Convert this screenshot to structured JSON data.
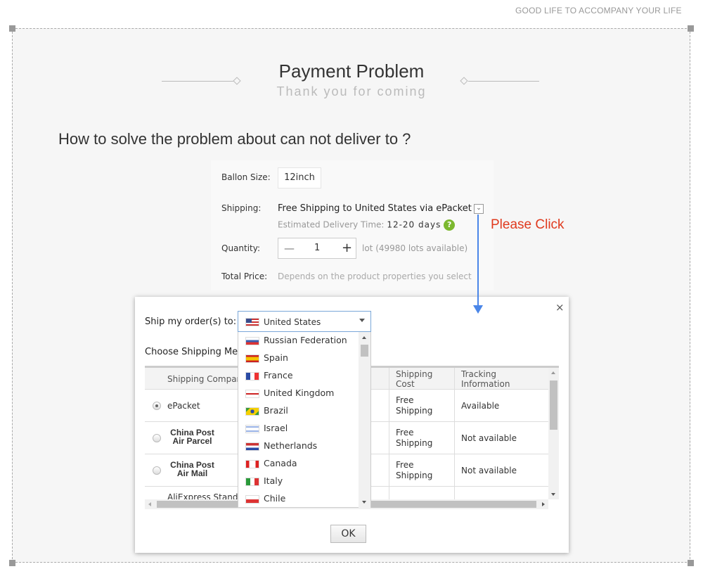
{
  "tagline": "GOOD LIFE TO ACCOMPANY YOUR LIFE",
  "header": {
    "title": "Payment Problem",
    "subtitle": "Thank you for coming"
  },
  "question": "How to solve the problem about can not deliver to ?",
  "product": {
    "size_label": "Ballon Size:",
    "size_value": "12inch",
    "shipping_label": "Shipping:",
    "shipping_value": "Free Shipping to United States via ePacket",
    "est_label": "Estimated Delivery Time:",
    "est_value": "12-20 days",
    "quantity_label": "Quantity:",
    "quantity_value": "1",
    "minus": "—",
    "plus": "+",
    "lot_text": "lot (49980 lots available)",
    "total_label": "Total Price:",
    "total_value": "Depends on the product properties you select"
  },
  "annotation": {
    "text": "Please Click",
    "color": "#e03a1e",
    "arrow_color": "#4a86e8"
  },
  "modal": {
    "close": "×",
    "ship_to_label": "Ship my order(s) to:",
    "selected_country": "United States",
    "choose_label": "Choose Shipping Me",
    "countries": [
      "Russian Federation",
      "Spain",
      "France",
      "United Kingdom",
      "Brazil",
      "Israel",
      "Netherlands",
      "Canada",
      "Italy",
      "Chile"
    ],
    "columns": {
      "company": "Shipping Compan",
      "cost": "Shipping Cost",
      "tracking": "Tracking Information"
    },
    "rows": [
      {
        "company": "ePacket",
        "cost": "Free Shipping",
        "tracking": "Available",
        "selected": true
      },
      {
        "company": "China Post Air Parcel",
        "cost": "Free Shipping",
        "tracking": "Not available",
        "selected": false
      },
      {
        "company": "China Post Air Mail",
        "cost": "Free Shipping",
        "tracking": "Not available",
        "selected": false
      },
      {
        "company": "AliExpress Standa",
        "cost": "",
        "tracking": "",
        "selected": false
      }
    ],
    "ok": "OK"
  }
}
